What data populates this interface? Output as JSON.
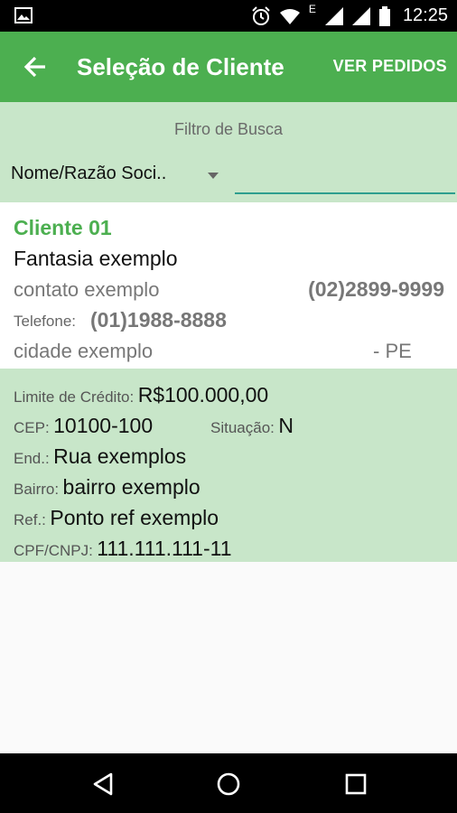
{
  "status_bar": {
    "time": "12:25",
    "network_letter": "E",
    "icons": [
      "image-icon",
      "alarm-icon",
      "wifi-icon",
      "signal-icon",
      "signal-icon",
      "battery-icon"
    ]
  },
  "app_bar": {
    "title": "Seleção de Cliente",
    "action_label": "VER PEDIDOS",
    "back_icon": "arrow-left-icon"
  },
  "filter": {
    "label": "Filtro de Busca",
    "selected_option": "Nome/Razão Soci..",
    "search_value": "",
    "search_placeholder": ""
  },
  "client": {
    "name": "Cliente 01",
    "fantasia": "Fantasia exemplo",
    "contato": "contato exemplo",
    "phone": "(02)2899-9999",
    "telefone_label": "Telefone:",
    "telefone_value": "(01)1988-8888",
    "cidade": "cidade exemplo",
    "uf": "- PE"
  },
  "details": {
    "limite_label": "Limite de Crédito:",
    "limite_value": "R$100.000,00",
    "cep_label": "CEP:",
    "cep_value": "10100-100",
    "situacao_label": "Situação:",
    "situacao_value": "N",
    "end_label": "End.:",
    "end_value": "Rua exemplos",
    "bairro_label": "Bairro:",
    "bairro_value": "bairro exemplo",
    "ref_label": "Ref.:",
    "ref_value": "Ponto ref exemplo",
    "cpf_label": "CPF/CNPJ:",
    "cpf_value": "111.111.111-11"
  },
  "colors": {
    "primary": "#4caf50",
    "light_green": "#c8e6c9",
    "accent_underline": "#2e9e8e"
  },
  "nav_bar": {
    "buttons": [
      "back-triangle-icon",
      "home-circle-icon",
      "recents-square-icon"
    ]
  }
}
